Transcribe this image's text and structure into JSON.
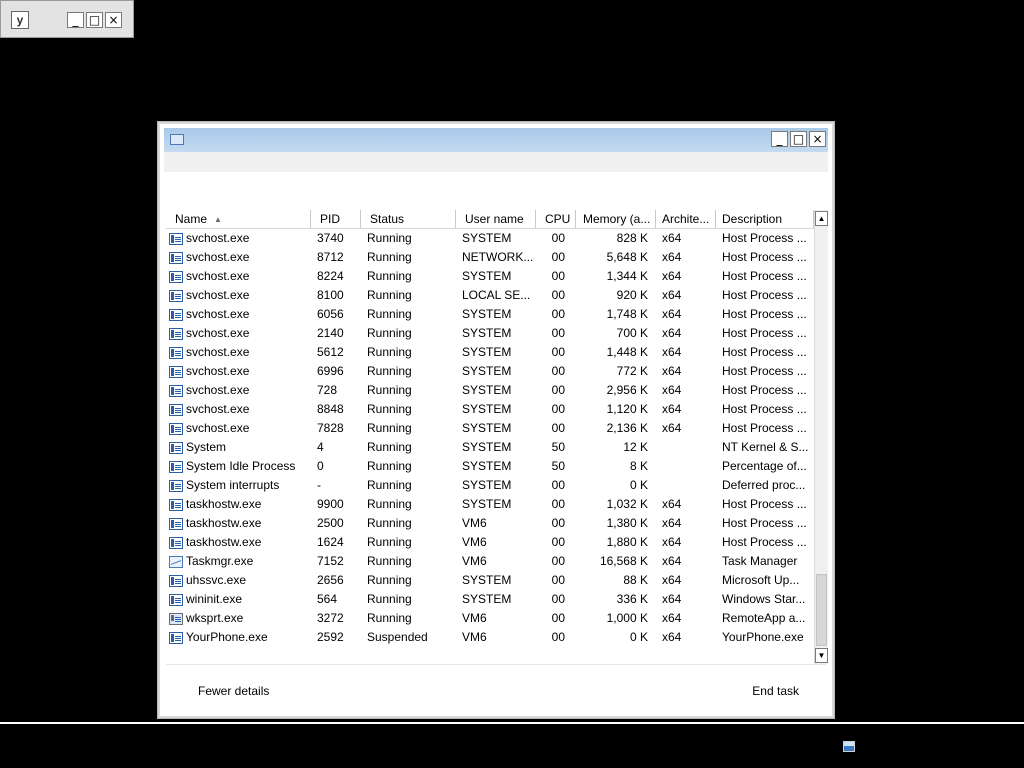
{
  "mini_window": {
    "icon_label": "y",
    "minimize": "_",
    "maximize": "□",
    "close": "×"
  },
  "window": {
    "minimize": "_",
    "maximize": "□",
    "close": "×"
  },
  "columns": [
    {
      "label": "Name",
      "sorted": "ascending"
    },
    {
      "label": "PID"
    },
    {
      "label": "Status"
    },
    {
      "label": "User name"
    },
    {
      "label": "CPU"
    },
    {
      "label": "Memory (a..."
    },
    {
      "label": "Archite..."
    },
    {
      "label": "Description"
    }
  ],
  "sort_arrow": "▲",
  "rows": [
    {
      "name": "svchost.exe",
      "pid": "3740",
      "status": "Running",
      "user": "SYSTEM",
      "cpu": "00",
      "mem": "828 K",
      "arch": "x64",
      "desc": "Host Process ..."
    },
    {
      "name": "svchost.exe",
      "pid": "8712",
      "status": "Running",
      "user": "NETWORK...",
      "cpu": "00",
      "mem": "5,648 K",
      "arch": "x64",
      "desc": "Host Process ..."
    },
    {
      "name": "svchost.exe",
      "pid": "8224",
      "status": "Running",
      "user": "SYSTEM",
      "cpu": "00",
      "mem": "1,344 K",
      "arch": "x64",
      "desc": "Host Process ..."
    },
    {
      "name": "svchost.exe",
      "pid": "8100",
      "status": "Running",
      "user": "LOCAL SE...",
      "cpu": "00",
      "mem": "920 K",
      "arch": "x64",
      "desc": "Host Process ..."
    },
    {
      "name": "svchost.exe",
      "pid": "6056",
      "status": "Running",
      "user": "SYSTEM",
      "cpu": "00",
      "mem": "1,748 K",
      "arch": "x64",
      "desc": "Host Process ..."
    },
    {
      "name": "svchost.exe",
      "pid": "2140",
      "status": "Running",
      "user": "SYSTEM",
      "cpu": "00",
      "mem": "700 K",
      "arch": "x64",
      "desc": "Host Process ..."
    },
    {
      "name": "svchost.exe",
      "pid": "5612",
      "status": "Running",
      "user": "SYSTEM",
      "cpu": "00",
      "mem": "1,448 K",
      "arch": "x64",
      "desc": "Host Process ..."
    },
    {
      "name": "svchost.exe",
      "pid": "6996",
      "status": "Running",
      "user": "SYSTEM",
      "cpu": "00",
      "mem": "772 K",
      "arch": "x64",
      "desc": "Host Process ..."
    },
    {
      "name": "svchost.exe",
      "pid": "728",
      "status": "Running",
      "user": "SYSTEM",
      "cpu": "00",
      "mem": "2,956 K",
      "arch": "x64",
      "desc": "Host Process ..."
    },
    {
      "name": "svchost.exe",
      "pid": "8848",
      "status": "Running",
      "user": "SYSTEM",
      "cpu": "00",
      "mem": "1,120 K",
      "arch": "x64",
      "desc": "Host Process ..."
    },
    {
      "name": "svchost.exe",
      "pid": "7828",
      "status": "Running",
      "user": "SYSTEM",
      "cpu": "00",
      "mem": "2,136 K",
      "arch": "x64",
      "desc": "Host Process ..."
    },
    {
      "name": "System",
      "pid": "4",
      "status": "Running",
      "user": "SYSTEM",
      "cpu": "50",
      "mem": "12 K",
      "arch": "",
      "desc": "NT Kernel & S..."
    },
    {
      "name": "System Idle Process",
      "pid": "0",
      "status": "Running",
      "user": "SYSTEM",
      "cpu": "50",
      "mem": "8 K",
      "arch": "",
      "desc": "Percentage of..."
    },
    {
      "name": "System interrupts",
      "pid": "-",
      "status": "Running",
      "user": "SYSTEM",
      "cpu": "00",
      "mem": "0 K",
      "arch": "",
      "desc": "Deferred proc..."
    },
    {
      "name": "taskhostw.exe",
      "pid": "9900",
      "status": "Running",
      "user": "SYSTEM",
      "cpu": "00",
      "mem": "1,032 K",
      "arch": "x64",
      "desc": "Host Process ..."
    },
    {
      "name": "taskhostw.exe",
      "pid": "2500",
      "status": "Running",
      "user": "VM6",
      "cpu": "00",
      "mem": "1,380 K",
      "arch": "x64",
      "desc": "Host Process ..."
    },
    {
      "name": "taskhostw.exe",
      "pid": "1624",
      "status": "Running",
      "user": "VM6",
      "cpu": "00",
      "mem": "1,880 K",
      "arch": "x64",
      "desc": "Host Process ..."
    },
    {
      "name": "Taskmgr.exe",
      "pid": "7152",
      "status": "Running",
      "user": "VM6",
      "cpu": "00",
      "mem": "16,568 K",
      "arch": "x64",
      "desc": "Task Manager",
      "icon": "chart"
    },
    {
      "name": "uhssvc.exe",
      "pid": "2656",
      "status": "Running",
      "user": "SYSTEM",
      "cpu": "00",
      "mem": "88 K",
      "arch": "x64",
      "desc": "Microsoft Up..."
    },
    {
      "name": "wininit.exe",
      "pid": "564",
      "status": "Running",
      "user": "SYSTEM",
      "cpu": "00",
      "mem": "336 K",
      "arch": "x64",
      "desc": "Windows Star..."
    },
    {
      "name": "wksprt.exe",
      "pid": "3272",
      "status": "Running",
      "user": "VM6",
      "cpu": "00",
      "mem": "1,000 K",
      "arch": "x64",
      "desc": "RemoteApp a...",
      "icon": "remote"
    },
    {
      "name": "YourPhone.exe",
      "pid": "2592",
      "status": "Suspended",
      "user": "VM6",
      "cpu": "00",
      "mem": "0 K",
      "arch": "x64",
      "desc": "YourPhone.exe"
    }
  ],
  "scroll": {
    "up": "▲",
    "down": "▼"
  },
  "footer": {
    "fewer_details": "Fewer details",
    "end_task": "End task"
  }
}
